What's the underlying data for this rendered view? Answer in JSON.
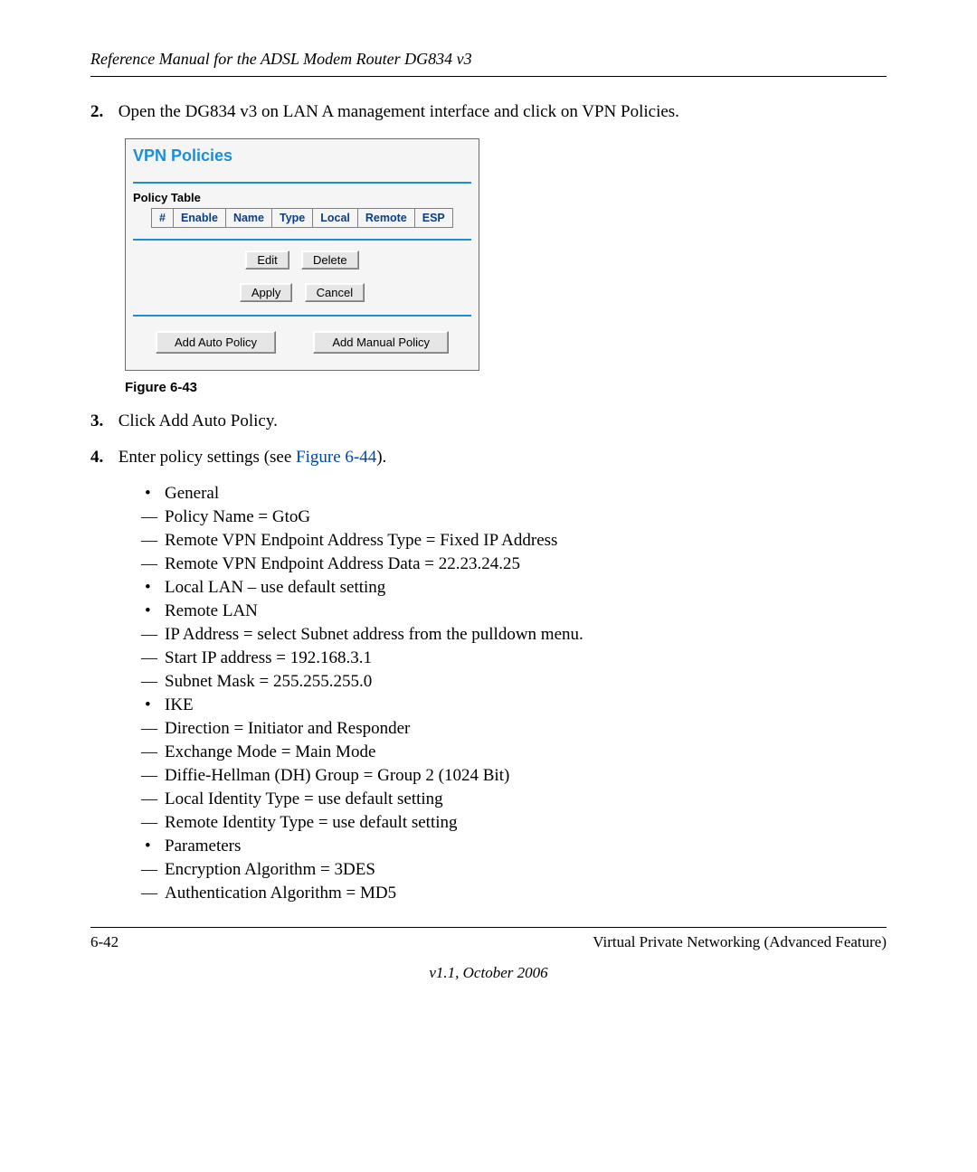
{
  "header": {
    "running_title": "Reference Manual for the ADSL Modem Router DG834 v3"
  },
  "steps": {
    "s2_num": "2.",
    "s2_text": "Open the DG834 v3 on LAN A management interface and click on VPN Policies.",
    "s3_num": "3.",
    "s3_text": "Click Add Auto Policy.",
    "s4_num": "4.",
    "s4_text_a": "Enter policy settings (see ",
    "s4_link": "Figure 6-44",
    "s4_text_b": ")."
  },
  "figure": {
    "caption": "Figure 6-43"
  },
  "panel": {
    "title": "VPN Policies",
    "section_label": "Policy Table",
    "headers": {
      "h1": "#",
      "h2": "Enable",
      "h3": "Name",
      "h4": "Type",
      "h5": "Local",
      "h6": "Remote",
      "h7": "ESP"
    },
    "buttons": {
      "edit": "Edit",
      "delete": "Delete",
      "apply": "Apply",
      "cancel": "Cancel",
      "add_auto": "Add Auto Policy",
      "add_manual": "Add Manual Policy"
    }
  },
  "bullets": {
    "b0": "General",
    "b1": "Policy Name = GtoG",
    "b2": "Remote VPN Endpoint Address Type = Fixed IP Address",
    "b3": "Remote VPN Endpoint Address Data = 22.23.24.25",
    "b4": "Local LAN – use default setting",
    "b5": "Remote LAN",
    "b6": "IP Address = select Subnet address from the pulldown menu.",
    "b7": "Start IP address = 192.168.3.1",
    "b8": "Subnet Mask = 255.255.255.0",
    "b9": "IKE",
    "b10": "Direction = Initiator and Responder",
    "b11": "Exchange Mode = Main Mode",
    "b12": "Diffie-Hellman (DH) Group = Group 2 (1024 Bit)",
    "b13": "Local Identity Type = use default setting",
    "b14": "Remote Identity Type = use default setting",
    "b15": "Parameters",
    "b16": "Encryption Algorithm = 3DES",
    "b17": "Authentication Algorithm = MD5"
  },
  "footer": {
    "page_num": "6-42",
    "section": "Virtual Private Networking (Advanced Feature)",
    "version": "v1.1, October 2006"
  }
}
